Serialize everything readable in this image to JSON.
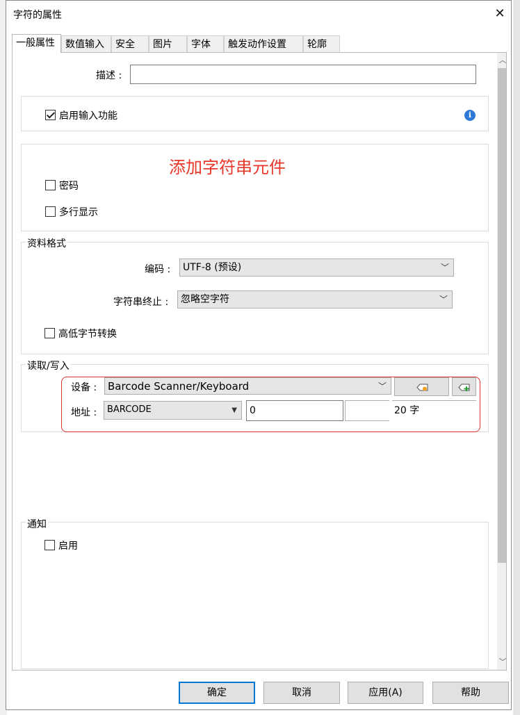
{
  "window": {
    "title": "字符的属性"
  },
  "tabs": [
    {
      "label": "一般属性"
    },
    {
      "label": "数值输入"
    },
    {
      "label": "安全"
    },
    {
      "label": "图片"
    },
    {
      "label": "字体"
    },
    {
      "label": "触发动作设置"
    },
    {
      "label": "轮廓"
    }
  ],
  "general": {
    "description_label": "描述 :",
    "description_value": "",
    "enable_input_label": "启用输入功能",
    "enable_input_checked": true,
    "annotation": "添加字符串元件",
    "password_label": "密码",
    "multiline_label": "多行显示"
  },
  "data_format": {
    "legend": "资料格式",
    "encoding_label": "编码 :",
    "encoding_value": "UTF-8 (预设)",
    "terminator_label": "字符串终止 :",
    "terminator_value": "忽略空字符",
    "byte_swap_label": "高低字节转换"
  },
  "read_write": {
    "legend": "读取/写入",
    "device_label": "设备 :",
    "device_value": "Barcode Scanner/Keyboard",
    "address_label": "地址 :",
    "address_type": "BARCODE",
    "address_value": "0",
    "address_extra": "",
    "length_text": "20 字"
  },
  "notification": {
    "legend": "通知",
    "enable_label": "启用"
  },
  "buttons": {
    "ok": "确定",
    "cancel": "取消",
    "apply": "应用(A)",
    "help": "帮助"
  },
  "colors": {
    "annotation": "#e8372a",
    "info_icon": "#2f7ad8",
    "default_button_border": "#0078d7"
  }
}
